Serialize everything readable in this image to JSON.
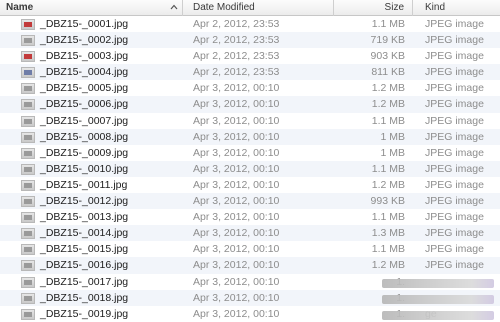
{
  "columns": {
    "name": "Name",
    "date": "Date Modified",
    "size": "Size",
    "kind": "Kind"
  },
  "files": [
    {
      "name": "_DBZ15-_0001.jpg",
      "date": "Apr 2, 2012, 23:53",
      "size": "1.1 MB",
      "kind": "JPEG image",
      "thumb": "red"
    },
    {
      "name": "_DBZ15-_0002.jpg",
      "date": "Apr 2, 2012, 23:53",
      "size": "719 KB",
      "kind": "JPEG image",
      "thumb": "gray"
    },
    {
      "name": "_DBZ15-_0003.jpg",
      "date": "Apr 2, 2012, 23:53",
      "size": "903 KB",
      "kind": "JPEG image",
      "thumb": "red"
    },
    {
      "name": "_DBZ15-_0004.jpg",
      "date": "Apr 2, 2012, 23:53",
      "size": "811 KB",
      "kind": "JPEG image",
      "thumb": "blue"
    },
    {
      "name": "_DBZ15-_0005.jpg",
      "date": "Apr 3, 2012, 00:10",
      "size": "1.2 MB",
      "kind": "JPEG image",
      "thumb": "gray"
    },
    {
      "name": "_DBZ15-_0006.jpg",
      "date": "Apr 3, 2012, 00:10",
      "size": "1.2 MB",
      "kind": "JPEG image",
      "thumb": "gray"
    },
    {
      "name": "_DBZ15-_0007.jpg",
      "date": "Apr 3, 2012, 00:10",
      "size": "1.1 MB",
      "kind": "JPEG image",
      "thumb": "gray"
    },
    {
      "name": "_DBZ15-_0008.jpg",
      "date": "Apr 3, 2012, 00:10",
      "size": "1 MB",
      "kind": "JPEG image",
      "thumb": "gray"
    },
    {
      "name": "_DBZ15-_0009.jpg",
      "date": "Apr 3, 2012, 00:10",
      "size": "1 MB",
      "kind": "JPEG image",
      "thumb": "gray"
    },
    {
      "name": "_DBZ15-_0010.jpg",
      "date": "Apr 3, 2012, 00:10",
      "size": "1.1 MB",
      "kind": "JPEG image",
      "thumb": "gray"
    },
    {
      "name": "_DBZ15-_0011.jpg",
      "date": "Apr 3, 2012, 00:10",
      "size": "1.2 MB",
      "kind": "JPEG image",
      "thumb": "gray"
    },
    {
      "name": "_DBZ15-_0012.jpg",
      "date": "Apr 3, 2012, 00:10",
      "size": "993 KB",
      "kind": "JPEG image",
      "thumb": "gray"
    },
    {
      "name": "_DBZ15-_0013.jpg",
      "date": "Apr 3, 2012, 00:10",
      "size": "1.1 MB",
      "kind": "JPEG image",
      "thumb": "gray"
    },
    {
      "name": "_DBZ15-_0014.jpg",
      "date": "Apr 3, 2012, 00:10",
      "size": "1.3 MB",
      "kind": "JPEG image",
      "thumb": "gray"
    },
    {
      "name": "_DBZ15-_0015.jpg",
      "date": "Apr 3, 2012, 00:10",
      "size": "1.1 MB",
      "kind": "JPEG image",
      "thumb": "gray"
    },
    {
      "name": "_DBZ15-_0016.jpg",
      "date": "Apr 3, 2012, 00:10",
      "size": "1.2 MB",
      "kind": "JPEG image",
      "thumb": "gray"
    },
    {
      "name": "_DBZ15-_0017.jpg",
      "date": "Apr 3, 2012, 00:10",
      "size": "1.",
      "kind": "",
      "thumb": "gray",
      "redacted": true
    },
    {
      "name": "_DBZ15-_0018.jpg",
      "date": "Apr 3, 2012, 00:10",
      "size": "1.",
      "kind": "",
      "thumb": "gray",
      "redacted": true
    },
    {
      "name": "_DBZ15-_0019.jpg",
      "date": "Apr 3, 2012, 00:10",
      "size": "1.",
      "kind": "ge",
      "thumb": "gray",
      "redacted": true
    }
  ]
}
